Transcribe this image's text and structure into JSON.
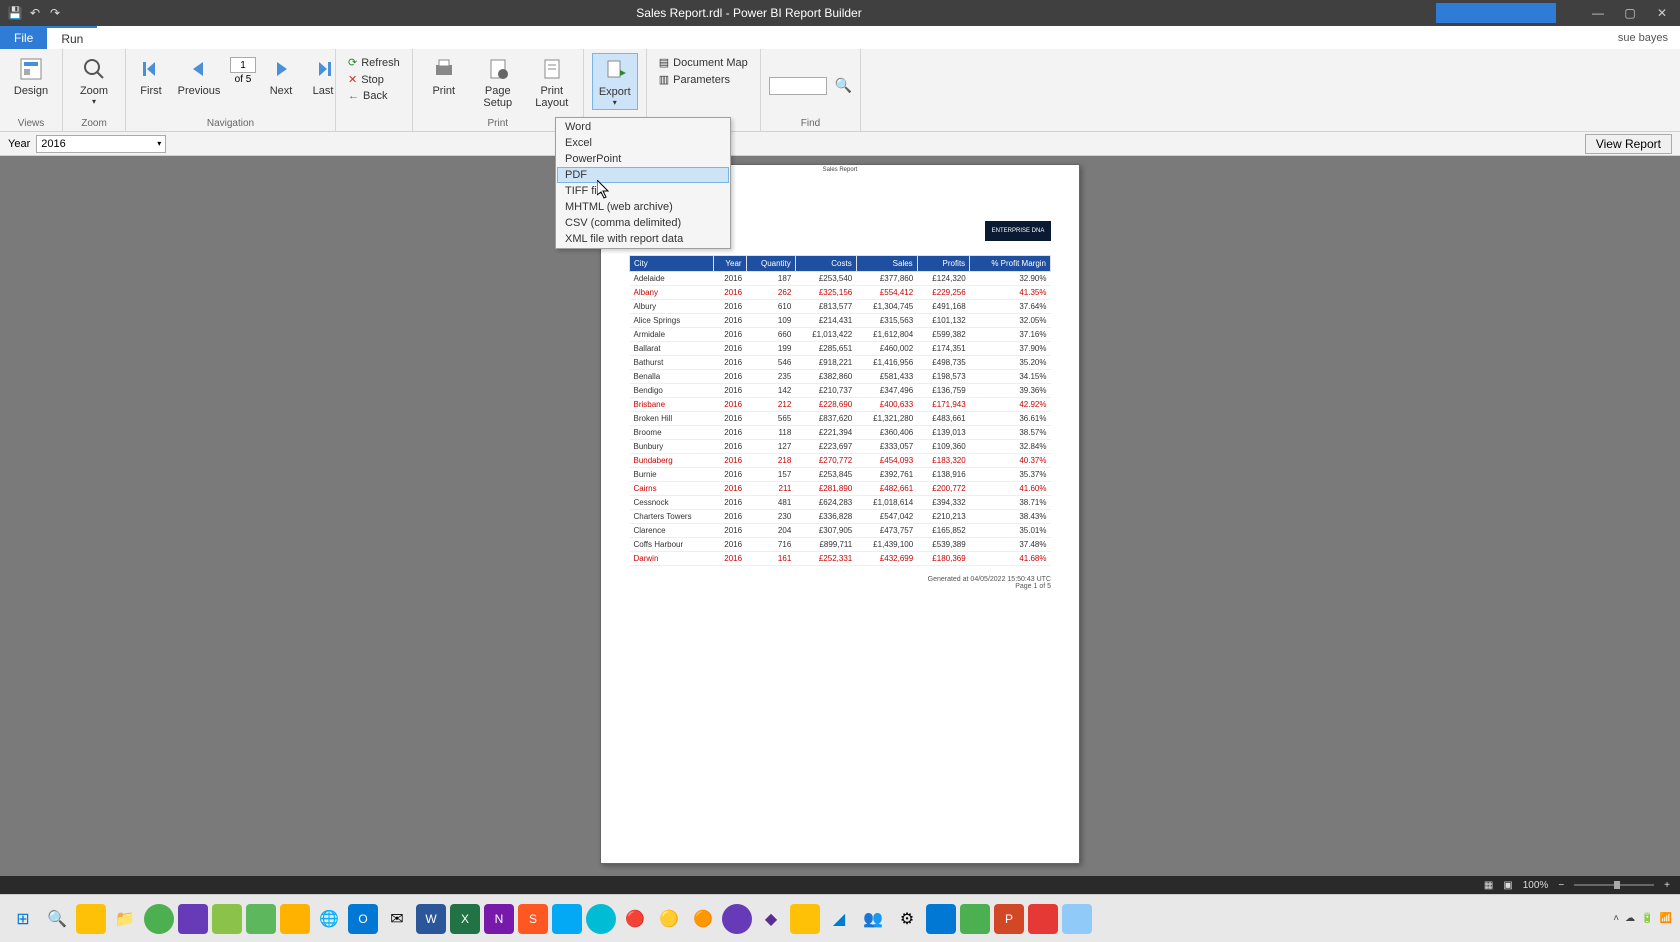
{
  "title": "Sales Report.rdl - Power BI Report Builder",
  "user": "sue bayes",
  "tabs": {
    "file": "File",
    "run": "Run"
  },
  "ribbon": {
    "views": {
      "design": "Design",
      "label": "Views"
    },
    "zoom": {
      "zoom": "Zoom",
      "label": "Zoom"
    },
    "nav": {
      "first": "First",
      "prev": "Previous",
      "next": "Next",
      "last": "Last",
      "page_num": "1",
      "page_of": "of  5",
      "label": "Navigation"
    },
    "run": {
      "refresh": "Refresh",
      "stop": "Stop",
      "back": "Back"
    },
    "print": {
      "print": "Print",
      "setup": "Page\nSetup",
      "layout": "Print\nLayout",
      "label": "Print"
    },
    "export": {
      "export": "Export"
    },
    "options": {
      "docmap": "Document Map",
      "params": "Parameters"
    },
    "find": {
      "label": "Find"
    }
  },
  "param": {
    "label": "Year",
    "value": "2016"
  },
  "view_report": "View Report",
  "export_menu": [
    "Word",
    "Excel",
    "PowerPoint",
    "PDF",
    "TIFF file",
    "MHTML (web archive)",
    "CSV (comma delimited)",
    "XML file with report data"
  ],
  "export_hover_idx": 3,
  "page_header": "Sales Report",
  "logo": "ENTERPRISE DNA",
  "columns": [
    "City",
    "Year",
    "Quantity",
    "Costs",
    "Sales",
    "Profits",
    "% Profit Margin"
  ],
  "rows": [
    {
      "c": "Adelaide",
      "y": "2016",
      "q": "187",
      "co": "£253,540",
      "s": "£377,860",
      "p": "£124,320",
      "m": "32.90%",
      "red": false
    },
    {
      "c": "Albany",
      "y": "2016",
      "q": "262",
      "co": "£325,156",
      "s": "£554,412",
      "p": "£229,256",
      "m": "41.35%",
      "red": true
    },
    {
      "c": "Albury",
      "y": "2016",
      "q": "610",
      "co": "£813,577",
      "s": "£1,304,745",
      "p": "£491,168",
      "m": "37.64%",
      "red": false
    },
    {
      "c": "Alice Springs",
      "y": "2016",
      "q": "109",
      "co": "£214,431",
      "s": "£315,563",
      "p": "£101,132",
      "m": "32.05%",
      "red": false
    },
    {
      "c": "Armidale",
      "y": "2016",
      "q": "660",
      "co": "£1,013,422",
      "s": "£1,612,804",
      "p": "£599,382",
      "m": "37.16%",
      "red": false
    },
    {
      "c": "Ballarat",
      "y": "2016",
      "q": "199",
      "co": "£285,651",
      "s": "£460,002",
      "p": "£174,351",
      "m": "37.90%",
      "red": false
    },
    {
      "c": "Bathurst",
      "y": "2016",
      "q": "546",
      "co": "£918,221",
      "s": "£1,416,956",
      "p": "£498,735",
      "m": "35.20%",
      "red": false
    },
    {
      "c": "Benalla",
      "y": "2016",
      "q": "235",
      "co": "£382,860",
      "s": "£581,433",
      "p": "£198,573",
      "m": "34.15%",
      "red": false
    },
    {
      "c": "Bendigo",
      "y": "2016",
      "q": "142",
      "co": "£210,737",
      "s": "£347,496",
      "p": "£136,759",
      "m": "39.36%",
      "red": false
    },
    {
      "c": "Brisbane",
      "y": "2016",
      "q": "212",
      "co": "£228,690",
      "s": "£400,633",
      "p": "£171,943",
      "m": "42.92%",
      "red": true
    },
    {
      "c": "Broken Hill",
      "y": "2016",
      "q": "565",
      "co": "£837,620",
      "s": "£1,321,280",
      "p": "£483,661",
      "m": "36.61%",
      "red": false
    },
    {
      "c": "Broome",
      "y": "2016",
      "q": "118",
      "co": "£221,394",
      "s": "£360,406",
      "p": "£139,013",
      "m": "38.57%",
      "red": false
    },
    {
      "c": "Bunbury",
      "y": "2016",
      "q": "127",
      "co": "£223,697",
      "s": "£333,057",
      "p": "£109,360",
      "m": "32.84%",
      "red": false
    },
    {
      "c": "Bundaberg",
      "y": "2016",
      "q": "218",
      "co": "£270,772",
      "s": "£454,093",
      "p": "£183,320",
      "m": "40.37%",
      "red": true
    },
    {
      "c": "Burnie",
      "y": "2016",
      "q": "157",
      "co": "£253,845",
      "s": "£392,761",
      "p": "£138,916",
      "m": "35.37%",
      "red": false
    },
    {
      "c": "Cairns",
      "y": "2016",
      "q": "211",
      "co": "£281,890",
      "s": "£482,661",
      "p": "£200,772",
      "m": "41.60%",
      "red": true
    },
    {
      "c": "Cessnock",
      "y": "2016",
      "q": "481",
      "co": "£624,283",
      "s": "£1,018,614",
      "p": "£394,332",
      "m": "38.71%",
      "red": false
    },
    {
      "c": "Charters Towers",
      "y": "2016",
      "q": "230",
      "co": "£336,828",
      "s": "£547,042",
      "p": "£210,213",
      "m": "38.43%",
      "red": false
    },
    {
      "c": "Clarence",
      "y": "2016",
      "q": "204",
      "co": "£307,905",
      "s": "£473,757",
      "p": "£165,852",
      "m": "35.01%",
      "red": false
    },
    {
      "c": "Coffs Harbour",
      "y": "2016",
      "q": "716",
      "co": "£899,711",
      "s": "£1,439,100",
      "p": "£539,389",
      "m": "37.48%",
      "red": false
    },
    {
      "c": "Darwin",
      "y": "2016",
      "q": "161",
      "co": "£252,331",
      "s": "£432,699",
      "p": "£180,369",
      "m": "41.68%",
      "red": true
    }
  ],
  "footer": {
    "gen": "Generated at 04/05/2022 15:50:43 UTC",
    "page": "Page 1 of 5"
  },
  "status": {
    "zoom": "100%"
  }
}
